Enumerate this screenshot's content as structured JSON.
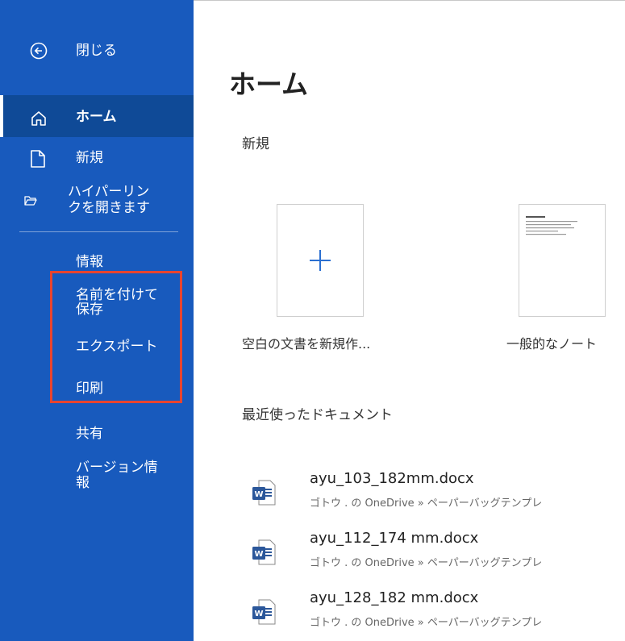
{
  "sidebar": {
    "close_label": "閉じる",
    "home_label": "ホーム",
    "new_label": "新規",
    "open_label_line1": "ハイパーリン",
    "open_label_line2": "クを開きます",
    "info_label": "情報",
    "saveas_label_line1": "名前を付けて",
    "saveas_label_line2": "保存",
    "export_label": "エクスポート",
    "print_label": "印刷",
    "share_label": "共有",
    "version_label_line1": "バージョン情",
    "version_label_line2": "報"
  },
  "main": {
    "title": "ホーム",
    "new_section": "新規",
    "templates": [
      {
        "caption": "空白の文書を新規作..."
      },
      {
        "caption": "一般的なノート"
      }
    ],
    "recent_section": "最近使ったドキュメント",
    "recent_docs": [
      {
        "name": "ayu_103_182mm.docx",
        "location": "ゴトウ . の OneDrive » ペーパーバッグテンプレ"
      },
      {
        "name": "ayu_112_174 mm.docx",
        "location": "ゴトウ . の OneDrive » ペーパーバッグテンプレ"
      },
      {
        "name": "ayu_128_182 mm.docx",
        "location": "ゴトウ . の OneDrive » ペーパーバッグテンプレ"
      }
    ]
  },
  "colors": {
    "sidebar_bg": "#185abd",
    "sidebar_active": "#0f4a97",
    "highlight": "#e8442f",
    "word_blue": "#2b579a"
  },
  "icons": [
    "back-arrow-icon",
    "home-icon",
    "new-document-icon",
    "folder-open-icon",
    "word-document-icon",
    "plus-icon"
  ]
}
